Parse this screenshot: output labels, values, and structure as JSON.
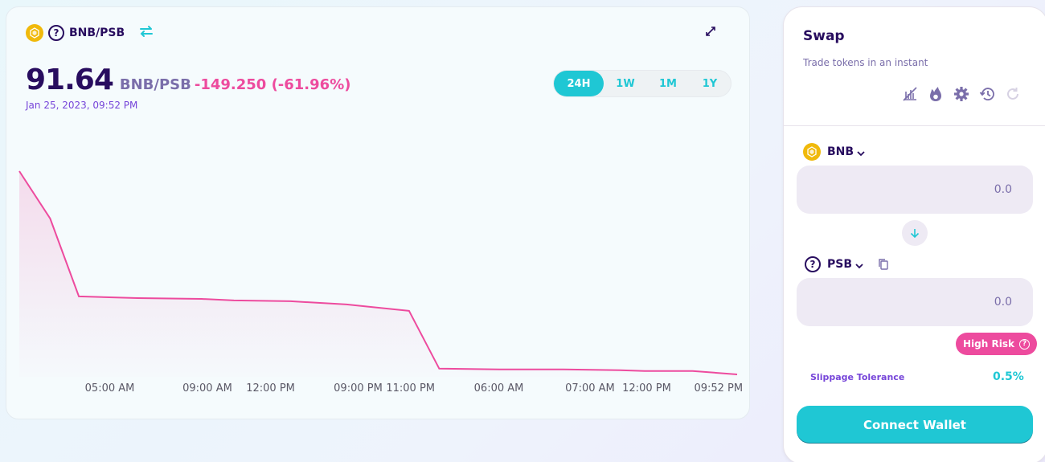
{
  "chart_header": {
    "base_token": "BNB",
    "quote_token_icon": "question-icon",
    "pair_label": "BNB/PSB",
    "swap_pair_icon": "swap-arrows-icon",
    "expand_icon": "expand-icon",
    "price": "91.64",
    "price_pair": "BNB/PSB",
    "price_change": "-149.250 (-61.96%)",
    "date": "Jan 25, 2023, 09:52 PM"
  },
  "range_tabs": [
    {
      "label": "24H",
      "active": true
    },
    {
      "label": "1W",
      "active": false
    },
    {
      "label": "1M",
      "active": false
    },
    {
      "label": "1Y",
      "active": false
    }
  ],
  "chart_data": {
    "type": "area",
    "title": "",
    "xlabel": "",
    "ylabel": "",
    "x_tick_labels": [
      "05:00 AM",
      "09:00 AM",
      "12:00 PM",
      "09:00 PM",
      "11:00 PM",
      "06:00 AM",
      "07:00 AM",
      "12:00 PM",
      "09:52 PM"
    ],
    "x_tick_positions": [
      0.126,
      0.262,
      0.35,
      0.472,
      0.545,
      0.668,
      0.795,
      0.874,
      0.974
    ],
    "x": [
      0,
      0.043,
      0.083,
      0.165,
      0.254,
      0.299,
      0.378,
      0.456,
      0.543,
      0.585,
      0.669,
      0.758,
      0.837,
      0.871,
      0.938,
      1
    ],
    "values": [
      240.89,
      206.1,
      148.9,
      147.7,
      147.1,
      146.0,
      145.4,
      143.0,
      138.3,
      95.9,
      95.3,
      95.3,
      94.7,
      94.2,
      94.2,
      91.64
    ],
    "ylim": [
      91.64,
      240.89
    ],
    "grid": false,
    "line_color": "#ed4b9e",
    "fill_color": "#ed4b9e"
  },
  "swap": {
    "title": "Swap",
    "subtitle": "Trade tokens in an instant",
    "tools": [
      "chart-toggle-icon",
      "fire-icon",
      "gear-icon",
      "history-icon",
      "refresh-icon"
    ],
    "from_token": "BNB",
    "from_amount_placeholder": "0.0",
    "to_token": "PSB",
    "to_amount_placeholder": "0.0",
    "risk_label": "High Risk",
    "slippage_label": "Slippage Tolerance",
    "slippage_value": "0.5%",
    "connect_label": "Connect Wallet"
  },
  "colors": {
    "accent": "#1fc7d4",
    "text_primary": "#280d5f",
    "text_secondary": "#7a6eaa",
    "negative": "#ed4b9e",
    "bnb": "#f0b90b"
  }
}
